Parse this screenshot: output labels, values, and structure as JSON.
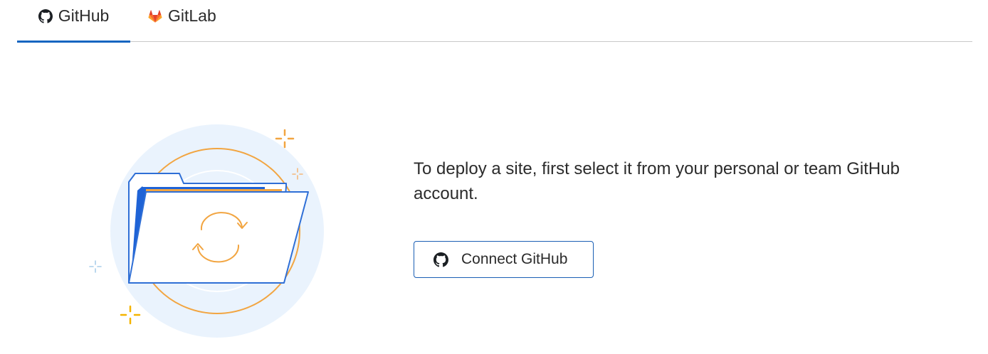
{
  "tabs": [
    {
      "label": "GitHub",
      "icon": "github-icon",
      "active": true
    },
    {
      "label": "GitLab",
      "icon": "gitlab-icon",
      "active": false
    }
  ],
  "main": {
    "message": "To deploy a site, first select it from your personal or team GitHub account.",
    "connect_button": {
      "label": "Connect GitHub",
      "icon": "github-icon"
    }
  },
  "colors": {
    "accent": "#1565c0",
    "button_border": "#1a5fb4",
    "illustration_orange": "#f2a541",
    "illustration_blue": "#2f6fd6",
    "illustration_bg": "#eaf3fd"
  }
}
